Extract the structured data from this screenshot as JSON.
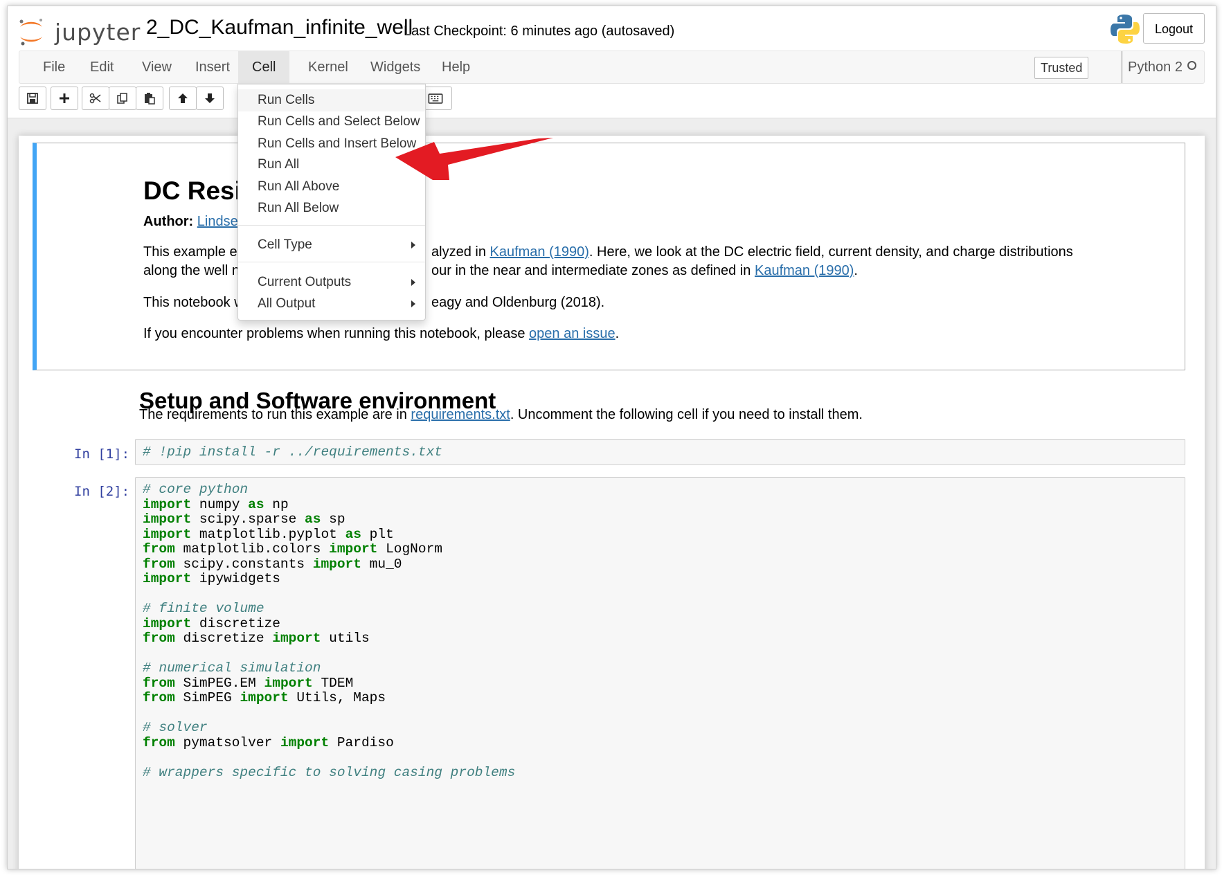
{
  "header": {
    "logo_text": "jupyter",
    "notebook_name": "2_DC_Kaufman_infinite_well",
    "checkpoint": "Last Checkpoint: 6 minutes ago (autosaved)",
    "logout_label": "Logout"
  },
  "menubar": {
    "items": [
      "File",
      "Edit",
      "View",
      "Insert",
      "Cell",
      "Kernel",
      "Widgets",
      "Help"
    ],
    "active": "Cell",
    "trusted_label": "Trusted",
    "kernel_name": "Python 2"
  },
  "toolbar": {
    "buttons": [
      "save-icon",
      "plus-icon",
      "cut-icon",
      "copy-icon",
      "paste-icon",
      "arrow-up-icon",
      "arrow-down-icon",
      "keyboard-icon"
    ]
  },
  "cell_menu": {
    "items": [
      "Run Cells",
      "Run Cells and Select Below",
      "Run Cells and Insert Below",
      "Run All",
      "Run All Above",
      "Run All Below"
    ],
    "cell_type": "Cell Type",
    "current_outputs": "Current Outputs",
    "all_output": "All Output"
  },
  "markdown": {
    "title": "DC Resis",
    "author_label": "Author:",
    "author_link": "Lindsey H",
    "p1_a": "This example exa",
    "p1_b": "alyzed in ",
    "p1_link1": "Kaufman (1990)",
    "p1_c": ". Here, we look at the DC electric field, current density, and charge distributions",
    "p2_a": "along the well nea",
    "p2_b": "our in the near and intermediate zones as defined in ",
    "p2_link": "Kaufman (1990)",
    "p2_c": ".",
    "p3_a": "This notebook wa",
    "p3_b": "eagy and Oldenburg (2018).",
    "p4_a": "If you encounter problems when running this notebook, please ",
    "p4_link": "open an issue",
    "p4_b": "."
  },
  "setup": {
    "heading": "Setup and Software environment",
    "text_a": "The requirements to run this example are in ",
    "text_link": "requirements.txt",
    "text_b": ". Uncomment the following cell if you need to install them."
  },
  "cells": {
    "prompt1": "In [1]:",
    "code1": "# !pip install -r ../requirements.txt",
    "prompt2": "In [2]:",
    "l01": "# core python",
    "l02_k": "import",
    "l02_a": " numpy ",
    "l02_k2": "as",
    "l02_b": " np",
    "l03_k": "import",
    "l03_a": " scipy.sparse ",
    "l03_k2": "as",
    "l03_b": " sp",
    "l04_k": "import",
    "l04_a": " matplotlib.pyplot ",
    "l04_k2": "as",
    "l04_b": " plt",
    "l05_k": "from",
    "l05_a": " matplotlib.colors ",
    "l05_k2": "import",
    "l05_b": " LogNorm",
    "l06_k": "from",
    "l06_a": " scipy.constants ",
    "l06_k2": "import",
    "l06_b": " mu_0",
    "l07_k": "import",
    "l07_a": " ipywidgets",
    "l09": "# finite volume",
    "l10_k": "import",
    "l10_a": " discretize",
    "l11_k": "from",
    "l11_a": " discretize ",
    "l11_k2": "import",
    "l11_b": " utils",
    "l13": "# numerical simulation",
    "l14_k": "from",
    "l14_a": " SimPEG.EM ",
    "l14_k2": "import",
    "l14_b": " TDEM",
    "l15_k": "from",
    "l15_a": " SimPEG ",
    "l15_k2": "import",
    "l15_b": " Utils, Maps",
    "l17": "# solver",
    "l18_k": "from",
    "l18_a": " pymatsolver ",
    "l18_k2": "import",
    "l18_b": " Pardiso",
    "l20": "# wrappers specific to solving casing problems"
  },
  "colors": {
    "accent_blue": "#42a5f5",
    "link": "#296eaa",
    "prompt": "#303f9f",
    "keyword": "#008000",
    "comment": "#408080",
    "annotation_arrow": "#e31b23"
  }
}
